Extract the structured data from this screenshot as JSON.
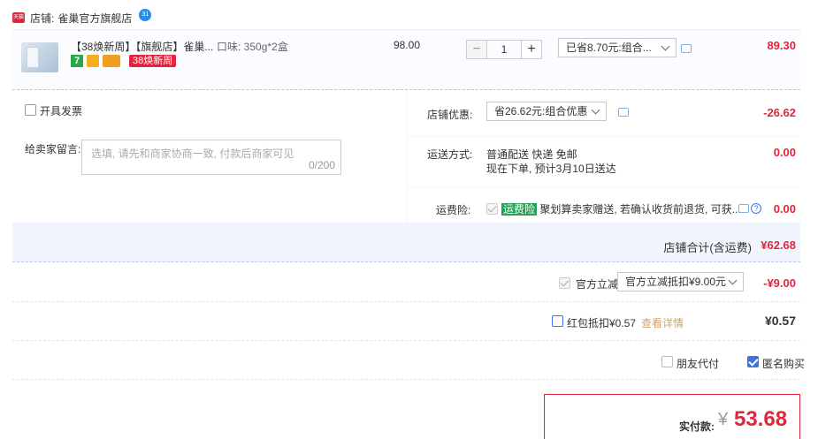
{
  "shop": {
    "badge": "天猫",
    "prefix": "店铺:",
    "name": "雀巢官方旗舰店",
    "wangwang": "31"
  },
  "item": {
    "title": "【38焕新周】【旗舰店】雀巢...",
    "spec": "口味: 350g*2盒",
    "tag_seven": "7",
    "promo_tag": "38焕新周",
    "unit_price": "98.00",
    "quantity": "1",
    "qty_minus": "−",
    "qty_plus": "+",
    "discount_select": "已省8.70元:组合...",
    "subtotal": "89.30"
  },
  "invoice": {
    "label": "开具发票"
  },
  "message": {
    "label": "给卖家留言:",
    "placeholder": "选填, 请先和商家协商一致, 付款后商家可见",
    "counter": "0/200"
  },
  "shop_discount": {
    "label": "店铺优惠:",
    "select": "省26.62元:组合优惠",
    "value": "-26.62"
  },
  "shipping": {
    "label": "运送方式:",
    "line1": "普通配送 快递 免邮",
    "line2": "现在下单, 预计3月10日送达",
    "value": "0.00"
  },
  "insurance": {
    "label": "运费险:",
    "tag": "运费险",
    "text": "聚划算卖家赠送, 若确认收货前退货, 可获...",
    "help": "?",
    "value": "0.00"
  },
  "shop_total": {
    "label": "店铺合计(含运费)",
    "value": "¥62.68"
  },
  "official_discount": {
    "label": "官方立减",
    "select": "官方立减抵扣¥9.00元",
    "value": "-¥9.00"
  },
  "red_packet": {
    "label": "红包抵扣¥0.57",
    "link": "查看详情",
    "value": "¥0.57"
  },
  "friend_pay": {
    "label": "朋友代付"
  },
  "anonymous": {
    "label": "匿名购买"
  },
  "payment": {
    "label": "实付款:",
    "currency": "¥",
    "amount": "53.68"
  },
  "colors": {
    "accent_red": "#e0263c",
    "blue": "#3b73e6",
    "green": "#29a05a"
  }
}
